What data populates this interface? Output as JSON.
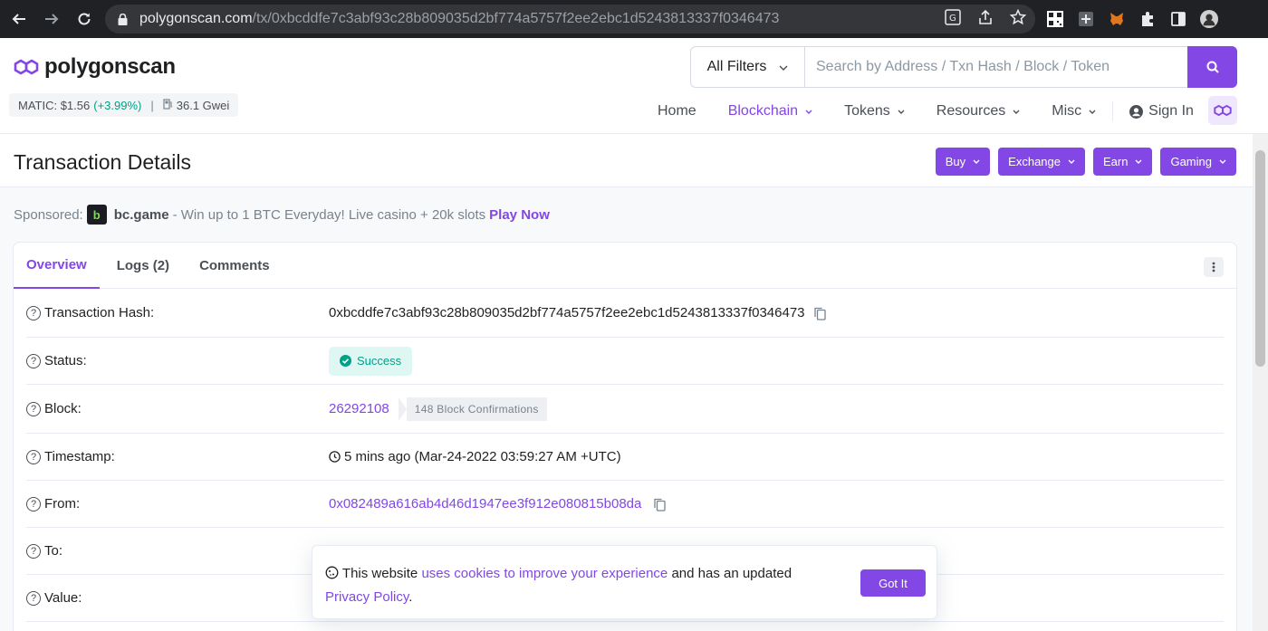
{
  "browser": {
    "url_host": "polygonscan.com",
    "url_path": "/tx/0xbcddfe7c3abf93c28b809035d2bf774a5757f2ee2ebc1d5243813337f0346473"
  },
  "header": {
    "logo_text": "polygonscan",
    "price_label": "MATIC: $1.56",
    "price_change": "(+3.99%)",
    "price_sep": "|",
    "gas": "36.1 Gwei",
    "search": {
      "filter_label": "All Filters",
      "placeholder": "Search by Address / Txn Hash / Block / Token"
    },
    "nav": {
      "home": "Home",
      "blockchain": "Blockchain",
      "tokens": "Tokens",
      "resources": "Resources",
      "misc": "Misc",
      "sign_in": "Sign In"
    }
  },
  "title_bar": {
    "title": "Transaction Details",
    "buttons": {
      "buy": "Buy",
      "exchange": "Exchange",
      "earn": "Earn",
      "gaming": "Gaming"
    }
  },
  "sponsored": {
    "label": "Sponsored:",
    "brand": "bc.game",
    "text": "- Win up to 1 BTC Everyday! Live casino + 20k slots",
    "cta": "Play Now"
  },
  "tabs": {
    "overview": "Overview",
    "logs": "Logs (2)",
    "comments": "Comments"
  },
  "details": {
    "tx_hash_label": "Transaction Hash:",
    "tx_hash": "0xbcddfe7c3abf93c28b809035d2bf774a5757f2ee2ebc1d5243813337f0346473",
    "status_label": "Status:",
    "status": "Success",
    "block_label": "Block:",
    "block": "26292108",
    "confirmations": "148 Block Confirmations",
    "timestamp_label": "Timestamp:",
    "timestamp": "5 mins ago (Mar-24-2022 03:59:27 AM +UTC)",
    "from_label": "From:",
    "from": "0x082489a616ab4d46d1947ee3f912e080815b08da",
    "to_label": "To:",
    "value_label": "Value:"
  },
  "cookie": {
    "text_1": "This website",
    "link_1": "uses cookies to improve your experience",
    "text_2": "and has an updated",
    "link_2": "Privacy Policy",
    "text_3": ".",
    "button": "Got It"
  },
  "colors": {
    "accent": "#8247e5",
    "success": "#00a186",
    "success_bg": "#def7f3"
  }
}
